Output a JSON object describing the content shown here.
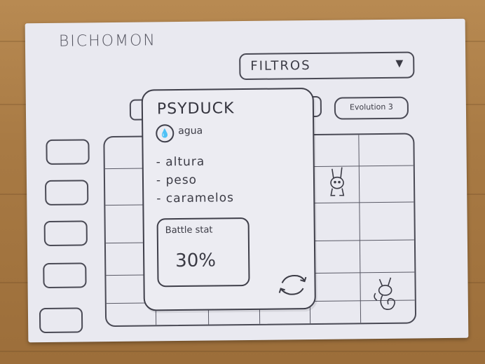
{
  "app": {
    "title": "BICHOMON"
  },
  "filters": {
    "label": "FILTROS",
    "caret_icon": "shield-caret-icon"
  },
  "evolution": {
    "label": "Evolution 3"
  },
  "side_buttons": [
    {},
    {},
    {},
    {},
    {}
  ],
  "card": {
    "name": "PSYDUCK",
    "type_icon": "water-drop-icon",
    "type_label": "agua",
    "stats": [
      "- altura",
      "- peso",
      "- caramelos"
    ],
    "battle": {
      "label": "Battle stat",
      "value": "30%"
    },
    "swap_icon": "refresh-arrows-icon"
  },
  "grid": {
    "sprites": [
      "rabbit-creature-sprite",
      "fox-creature-sprite"
    ]
  },
  "colors": {
    "ink": "#3b3b45",
    "paper": "#e9e9f0",
    "table": "#a87a44"
  }
}
